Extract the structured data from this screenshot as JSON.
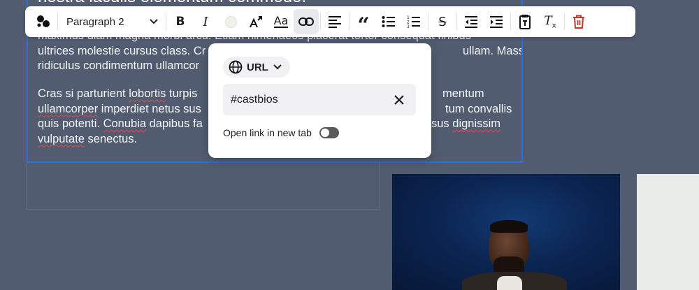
{
  "editor": {
    "heading_fragment": "nostra iaculis elementum commodo.",
    "paragraph1_lines": [
      "maximus diam magna morbi arcu. Etiam himenaeos placerat tortor consequat finibus",
      "ultrices molestie cursus class. Cr",
      "ridiculus condimentum ullamcor"
    ],
    "paragraph1_right": [
      "ullam. Massa",
      ""
    ],
    "paragraph2_lines": [
      "Cras si parturient lobortis turpis",
      "ullamcorper imperdiet netus sus",
      "quis potenti. Conubia dapibus fa",
      "vulputate senectus."
    ],
    "paragraph2_right": [
      "mentum",
      "tum convallis",
      "sus dignissim"
    ]
  },
  "toolbar": {
    "block_style": "Paragraph 2",
    "bold": "B",
    "italic": "I",
    "font_style": "Aa",
    "quote": "“",
    "strike": "S",
    "clear_format": "T",
    "clear_format_sub": "x",
    "icons": [
      "blocks-icon",
      "chevron-down-icon",
      "bold-icon",
      "italic-icon",
      "text-color-icon",
      "font-size-icon",
      "font-style-icon",
      "link-icon",
      "align-left-icon",
      "quote-icon",
      "bullet-list-icon",
      "numbered-list-icon",
      "strikethrough-icon",
      "outdent-icon",
      "indent-icon",
      "paste-text-icon",
      "clear-format-icon",
      "trash-icon"
    ],
    "colors": {
      "trash": "#c0392b",
      "active_bg": "#e8e9ec"
    }
  },
  "link_popover": {
    "type_label": "URL",
    "url_value": "#castbios",
    "new_tab_label": "Open link in new tab",
    "new_tab_enabled": false
  },
  "colors": {
    "canvas": "#525c70",
    "selection": "#2f6fd6"
  }
}
